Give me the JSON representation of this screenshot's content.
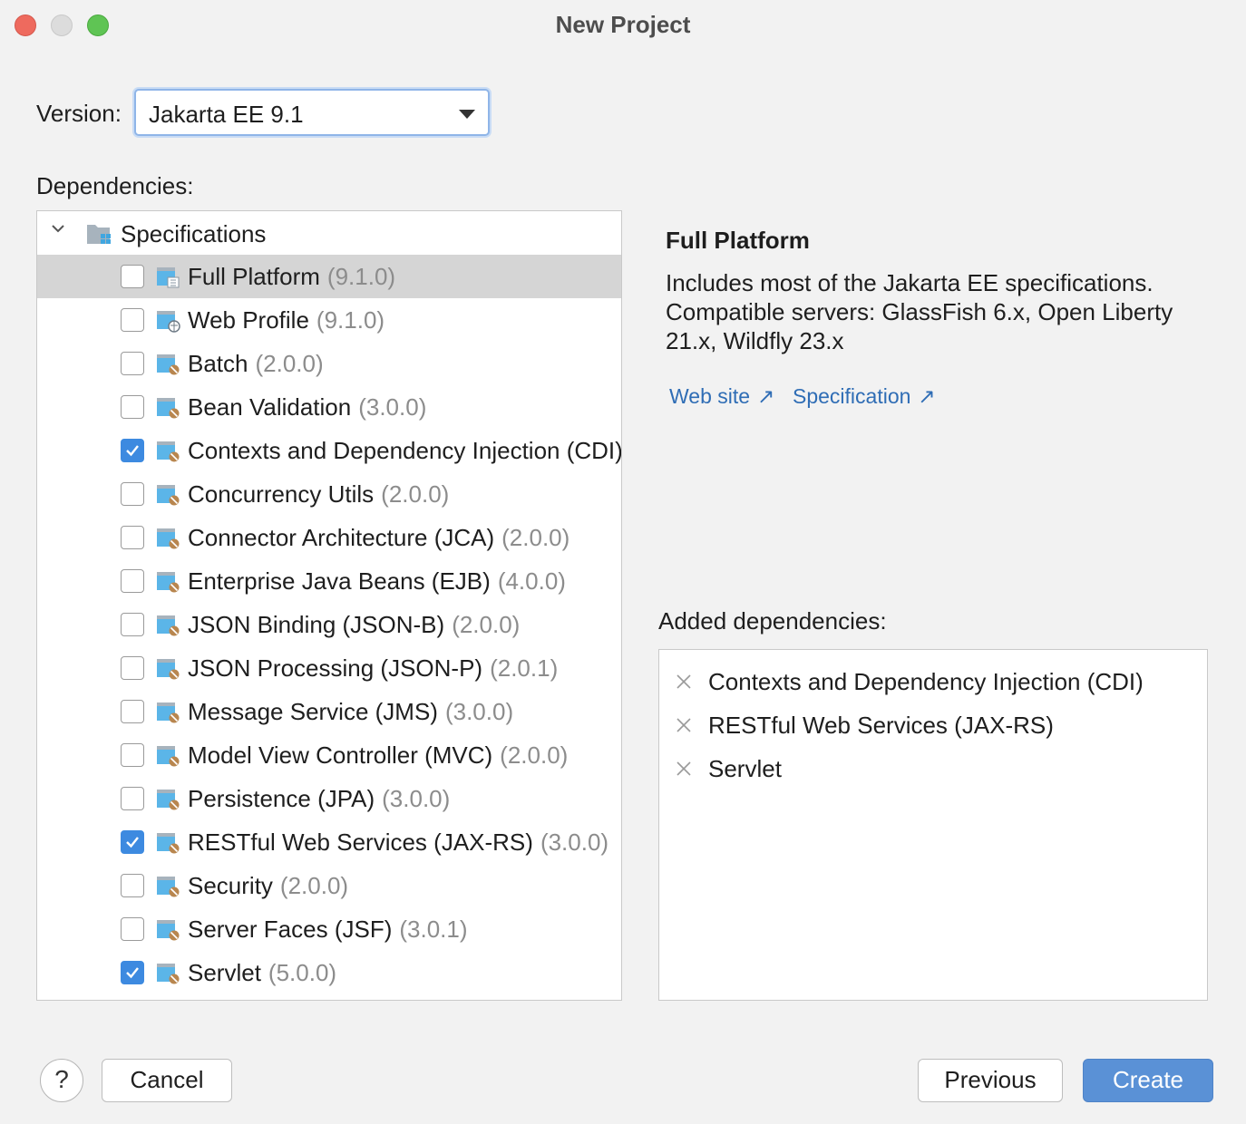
{
  "window": {
    "title": "New Project"
  },
  "version": {
    "label": "Version:",
    "value": "Jakarta EE 9.1"
  },
  "dependencies": {
    "label": "Dependencies:",
    "root": "Specifications",
    "items": [
      {
        "name": "Full Platform",
        "version": "(9.1.0)",
        "checked": false,
        "selected": true,
        "icon": "platform-icon"
      },
      {
        "name": "Web Profile",
        "version": "(9.1.0)",
        "checked": false,
        "selected": false,
        "icon": "web-profile-icon"
      },
      {
        "name": "Batch",
        "version": "(2.0.0)",
        "checked": false,
        "selected": false,
        "icon": "library-icon"
      },
      {
        "name": "Bean Validation",
        "version": "(3.0.0)",
        "checked": false,
        "selected": false,
        "icon": "library-icon"
      },
      {
        "name": "Contexts and Dependency Injection (CDI)",
        "version": "(3.0.0)",
        "checked": true,
        "selected": false,
        "icon": "library-icon"
      },
      {
        "name": "Concurrency Utils",
        "version": "(2.0.0)",
        "checked": false,
        "selected": false,
        "icon": "library-icon"
      },
      {
        "name": "Connector Architecture (JCA)",
        "version": "(2.0.0)",
        "checked": false,
        "selected": false,
        "icon": "library-icon"
      },
      {
        "name": "Enterprise Java Beans (EJB)",
        "version": "(4.0.0)",
        "checked": false,
        "selected": false,
        "icon": "library-icon"
      },
      {
        "name": "JSON Binding (JSON-B)",
        "version": "(2.0.0)",
        "checked": false,
        "selected": false,
        "icon": "library-icon"
      },
      {
        "name": "JSON Processing (JSON-P)",
        "version": "(2.0.1)",
        "checked": false,
        "selected": false,
        "icon": "library-icon"
      },
      {
        "name": "Message Service (JMS)",
        "version": "(3.0.0)",
        "checked": false,
        "selected": false,
        "icon": "library-icon"
      },
      {
        "name": "Model View Controller (MVC)",
        "version": "(2.0.0)",
        "checked": false,
        "selected": false,
        "icon": "library-icon"
      },
      {
        "name": "Persistence (JPA)",
        "version": "(3.0.0)",
        "checked": false,
        "selected": false,
        "icon": "library-icon"
      },
      {
        "name": "RESTful Web Services (JAX-RS)",
        "version": "(3.0.0)",
        "checked": true,
        "selected": false,
        "icon": "library-icon"
      },
      {
        "name": "Security",
        "version": "(2.0.0)",
        "checked": false,
        "selected": false,
        "icon": "library-icon"
      },
      {
        "name": "Server Faces (JSF)",
        "version": "(3.0.1)",
        "checked": false,
        "selected": false,
        "icon": "library-icon"
      },
      {
        "name": "Servlet",
        "version": "(5.0.0)",
        "checked": true,
        "selected": false,
        "icon": "library-icon"
      }
    ]
  },
  "info": {
    "title": "Full Platform",
    "description": "Includes most of the Jakarta EE specifications. Compatible servers: GlassFish 6.x, Open Liberty 21.x, Wildfly 23.x",
    "links": [
      {
        "label": "Web site"
      },
      {
        "label": "Specification"
      }
    ]
  },
  "added": {
    "label": "Added dependencies:",
    "items": [
      "Contexts and Dependency Injection (CDI)",
      "RESTful Web Services (JAX-RS)",
      "Servlet"
    ]
  },
  "buttons": {
    "help": "?",
    "cancel": "Cancel",
    "previous": "Previous",
    "create": "Create"
  },
  "colors": {
    "accent": "#3d8ae0",
    "link": "#2f6db5",
    "primary_button": "#5a91d6",
    "selection": "#d5d5d5"
  }
}
